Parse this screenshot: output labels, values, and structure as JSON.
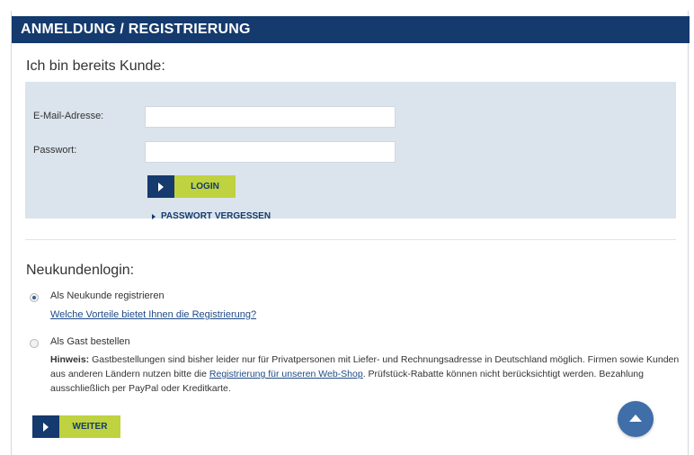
{
  "header": {
    "title": "ANMELDUNG / REGISTRIERUNG"
  },
  "existing_customer": {
    "title": "Ich bin bereits Kunde:",
    "email_label": "E-Mail-Adresse:",
    "email_value": "",
    "password_label": "Passwort:",
    "password_value": "",
    "login_label": "LOGIN",
    "forgot_label": "PASSWORT VERGESSEN"
  },
  "new_customer": {
    "title": "Neukundenlogin:",
    "option_register": {
      "label": "Als Neukunde registrieren",
      "selected": true
    },
    "benefits_link": "Welche Vorteile bietet Ihnen die Registrierung?",
    "option_guest": {
      "label": "Als Gast bestellen",
      "selected": false
    },
    "hint_prefix": "Hinweis:",
    "hint_text_1": " Gastbestellungen sind bisher leider nur für Privatpersonen mit Liefer- und Rechnungsadresse in Deutschland möglich. Firmen sowie Kunden aus anderen Ländern nutzen bitte die ",
    "hint_link": "Registrierung für unseren Web-Shop",
    "hint_text_2": ". Prüfstück-Rabatte können nicht berücksichtigt werden. Bezahlung ausschließlich per PayPal oder Kreditkarte.",
    "continue_label": "WEITER"
  },
  "icons": {
    "button_arrow": "play-arrow-icon",
    "link_arrow": "caret-right-icon",
    "scroll_top": "chevron-up-icon"
  },
  "colors": {
    "brand_blue": "#143a6e",
    "accent_green": "#bfd23f",
    "panel_bg": "#dbe4ec",
    "scroll_button": "#3f6ea8"
  }
}
